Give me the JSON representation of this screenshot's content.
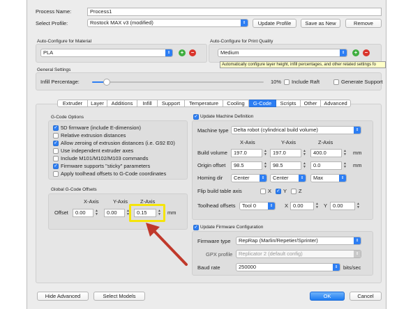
{
  "process_name_label": "Process Name:",
  "process_name_value": "Process1",
  "select_profile_label": "Select Profile:",
  "select_profile_value": "Rostock MAX v3 (modified)",
  "update_profile_btn": "Update Profile",
  "save_as_new_btn": "Save as New",
  "remove_btn": "Remove",
  "auto_material": {
    "label": "Auto-Configure for Material",
    "value": "PLA"
  },
  "auto_quality": {
    "label": "Auto-Configure for Print Quality",
    "value": "Medium"
  },
  "tooltip": "Automatically configure layer height, infill percentages, and other related settings fo",
  "general": {
    "label": "General Settings",
    "infill_label": "Infill Percentage:",
    "infill_value": "10%",
    "infill_fraction": 0.1,
    "include_raft": "Include Raft",
    "generate_support": "Generate Support"
  },
  "tabs": [
    "Extruder",
    "Layer",
    "Additions",
    "Infill",
    "Support",
    "Temperature",
    "Cooling",
    "G-Code",
    "Scripts",
    "Other",
    "Advanced"
  ],
  "active_tab": "G-Code",
  "gcode_options": {
    "label": "G-Code Options",
    "items": [
      {
        "label": "5D firmware (include E-dimension)",
        "checked": true
      },
      {
        "label": "Relative extrusion distances",
        "checked": false
      },
      {
        "label": "Allow zeroing of extrusion distances (i.e. G92 E0)",
        "checked": true
      },
      {
        "label": "Use independent extruder axes",
        "checked": false
      },
      {
        "label": "Include M101/M102/M103 commands",
        "checked": false
      },
      {
        "label": "Firmware supports \"sticky\" parameters",
        "checked": true
      },
      {
        "label": "Apply toolhead offsets to G-Code coordinates",
        "checked": false
      }
    ]
  },
  "global_offsets": {
    "label": "Global G-Code Offsets",
    "x_axis": "X-Axis",
    "y_axis": "Y-Axis",
    "z_axis": "Z-Axis",
    "offset_label": "Offset",
    "x": "0.00",
    "y": "0.00",
    "z": "0.15",
    "unit": "mm"
  },
  "machine": {
    "update_label": "Update Machine Definition",
    "type_label": "Machine type",
    "type_value": "Delta robot (cylindrical build volume)",
    "x_axis": "X-Axis",
    "y_axis": "Y-Axis",
    "z_axis": "Z-Axis",
    "build_volume_label": "Build volume",
    "build_volume": [
      "197.0",
      "197.0",
      "400.0"
    ],
    "origin_offset_label": "Origin offset",
    "origin_offset": [
      "98.5",
      "98.5",
      "0.0"
    ],
    "homing_label": "Homing dir",
    "homing": [
      "Center",
      "Center",
      "Max"
    ],
    "flip_label": "Flip build table axis",
    "flip_x": "X",
    "flip_y": "Y",
    "flip_z": "Z",
    "toolhead_label": "Toolhead offsets",
    "toolhead_value": "Tool 0",
    "tool_x_label": "X",
    "tool_x": "0.00",
    "tool_y_label": "Y",
    "tool_y": "0.00",
    "unit": "mm"
  },
  "firmware": {
    "update_label": "Update Firmware Configuration",
    "type_label": "Firmware type",
    "type_value": "RepRap (Marlin/Repetier/Sprinter)",
    "gpx_label": "GPX profile",
    "gpx_value": "Replicator 2 (default config)",
    "baud_label": "Baud rate",
    "baud_value": "250000",
    "baud_unit": "bits/sec"
  },
  "footer": {
    "hide_advanced": "Hide Advanced",
    "select_models": "Select Models",
    "ok": "OK",
    "cancel": "Cancel"
  }
}
